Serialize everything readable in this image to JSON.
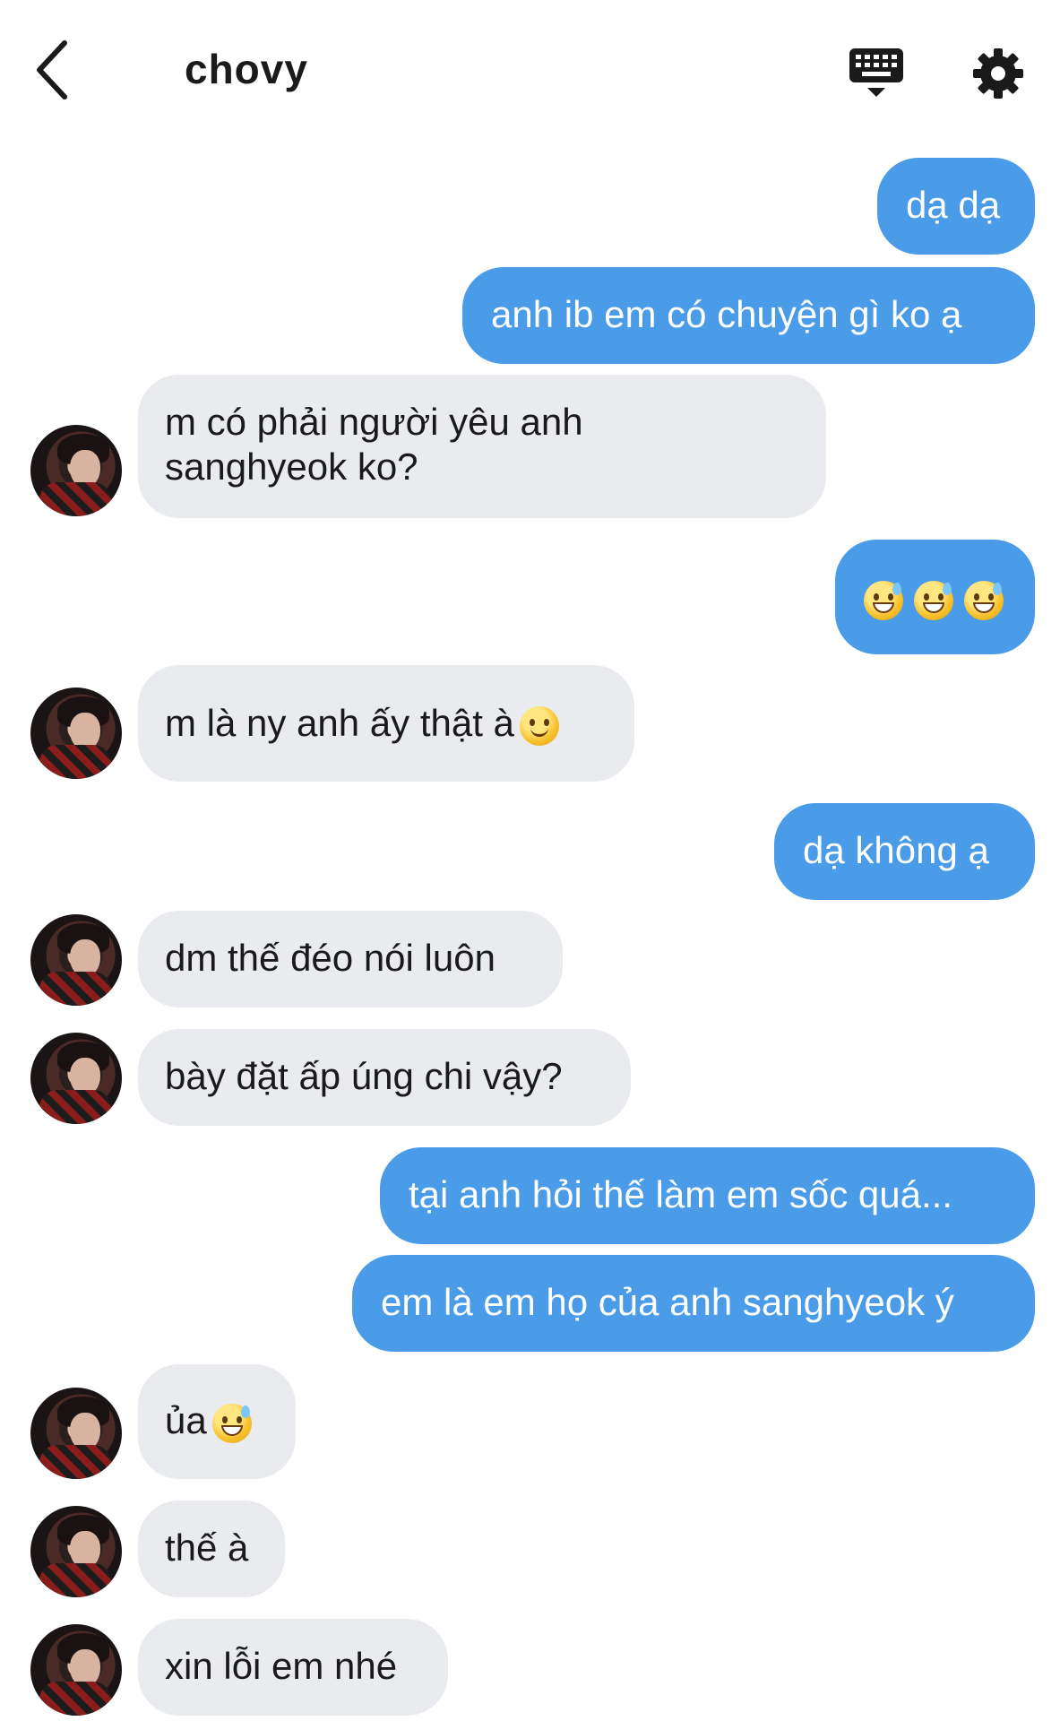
{
  "header": {
    "title": "chovy",
    "back_icon": "chevron-left-icon",
    "keyboard_icon": "keyboard-icon",
    "settings_icon": "gear-icon"
  },
  "colors": {
    "outgoing_bubble": "#4a9be8",
    "incoming_bubble": "#e9ebef",
    "background": "#ffffff"
  },
  "messages": [
    {
      "side": "out",
      "text": "dạ dạ"
    },
    {
      "side": "out",
      "text": "anh ib em có chuyện gì ko ạ"
    },
    {
      "side": "in",
      "text_line1": "m có phải người yêu anh",
      "text_line2": "sanghyeok ko?"
    },
    {
      "side": "out",
      "text": "",
      "emoji": [
        "grinning-sweat-emoji",
        "grinning-sweat-emoji",
        "grinning-sweat-emoji"
      ]
    },
    {
      "side": "in",
      "text": "m là ny anh ấy thật à",
      "emoji": [
        "slightly-smiling-emoji"
      ]
    },
    {
      "side": "out",
      "text": "dạ không ạ"
    },
    {
      "side": "in",
      "text": "dm thế đéo nói luôn"
    },
    {
      "side": "in",
      "text": "bày đặt ấp úng chi vậy?"
    },
    {
      "side": "out",
      "text": "tại anh hỏi thế làm em sốc quá..."
    },
    {
      "side": "out",
      "text": "em là em họ của anh sanghyeok ý"
    },
    {
      "side": "in",
      "text": "ủa",
      "emoji": [
        "grinning-sweat-emoji"
      ]
    },
    {
      "side": "in",
      "text": "thế à"
    },
    {
      "side": "in",
      "text": "xin lỗi em nhé"
    }
  ]
}
